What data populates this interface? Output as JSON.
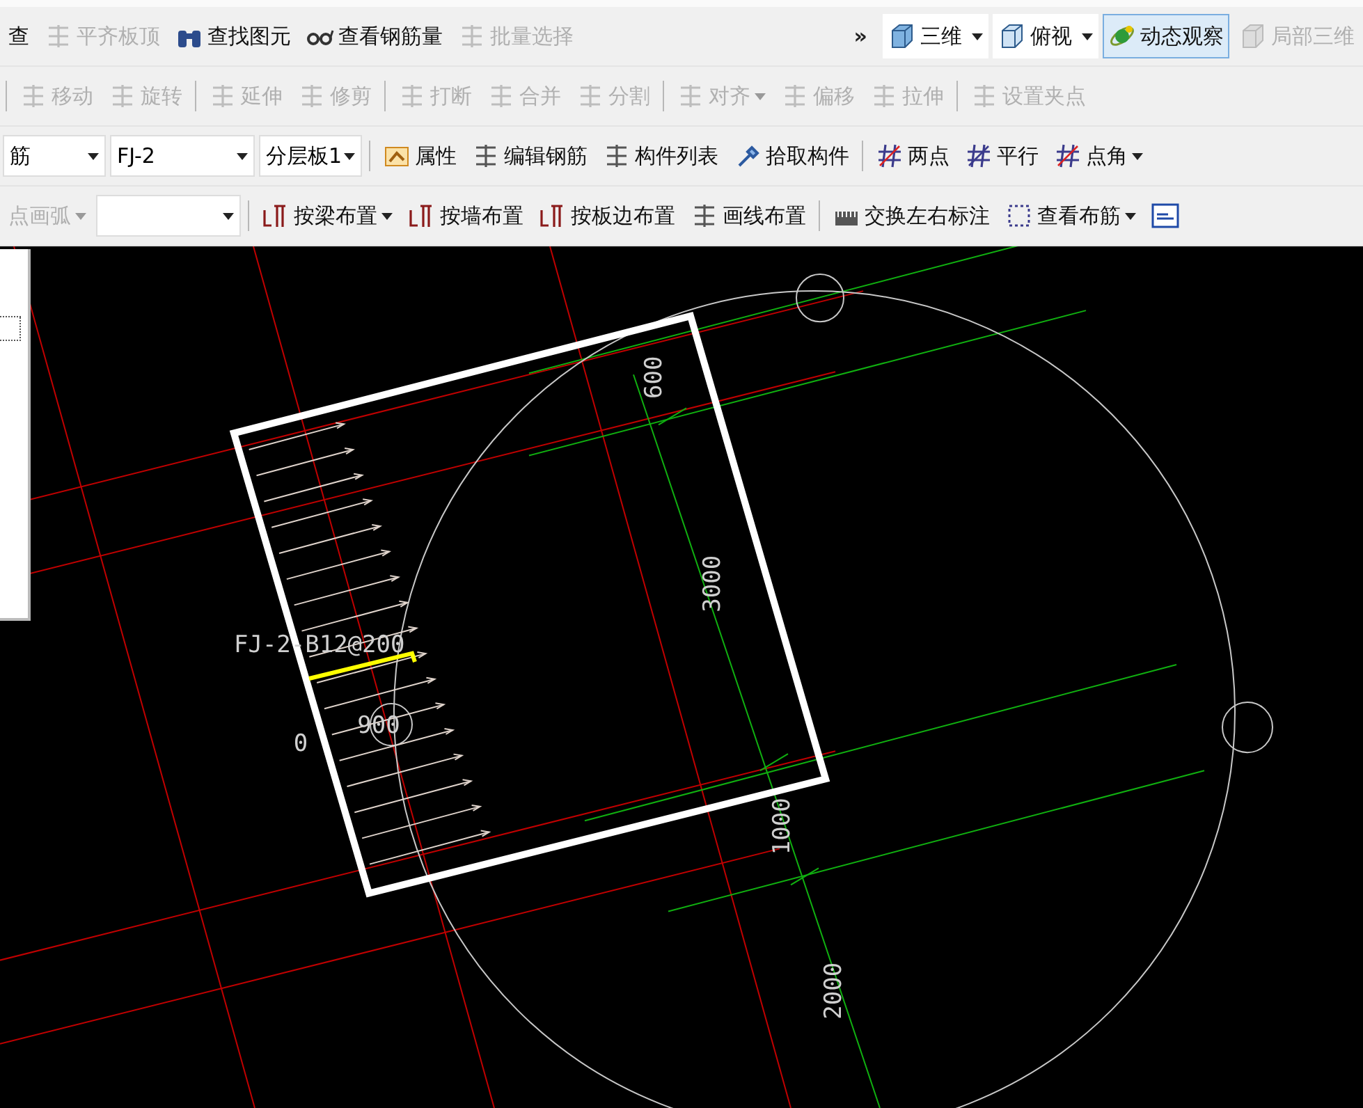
{
  "toolbar_rows": [
    {
      "items": [
        {
          "kind": "label",
          "label": "查",
          "disabled": false
        },
        {
          "kind": "button",
          "label": "平齐板顶",
          "disabled": true
        },
        {
          "kind": "button",
          "label": "查找图元",
          "disabled": false
        },
        {
          "kind": "button",
          "label": "查看钢筋量",
          "disabled": false
        },
        {
          "kind": "button",
          "label": "批量选择",
          "disabled": true
        },
        {
          "kind": "more",
          "label": "»"
        },
        {
          "kind": "split",
          "label": "三维"
        },
        {
          "kind": "split",
          "label": "俯视"
        },
        {
          "kind": "button",
          "label": "动态观察",
          "selected": true
        },
        {
          "kind": "button",
          "label": "局部三维",
          "disabled": true
        }
      ]
    },
    {
      "items": [
        {
          "kind": "separator"
        },
        {
          "kind": "button",
          "label": "移动",
          "disabled": true
        },
        {
          "kind": "button",
          "label": "旋转",
          "disabled": true
        },
        {
          "kind": "separator"
        },
        {
          "kind": "button",
          "label": "延伸",
          "disabled": true
        },
        {
          "kind": "button",
          "label": "修剪",
          "disabled": true
        },
        {
          "kind": "separator"
        },
        {
          "kind": "button",
          "label": "打断",
          "disabled": true
        },
        {
          "kind": "button",
          "label": "合并",
          "disabled": true
        },
        {
          "kind": "button",
          "label": "分割",
          "disabled": true
        },
        {
          "kind": "separator"
        },
        {
          "kind": "button",
          "label": "对齐",
          "disabled": true,
          "dropdown": true
        },
        {
          "kind": "button",
          "label": "偏移",
          "disabled": true
        },
        {
          "kind": "button",
          "label": "拉伸",
          "disabled": true
        },
        {
          "kind": "separator"
        },
        {
          "kind": "button",
          "label": "设置夹点",
          "disabled": true
        }
      ]
    },
    {
      "items": [
        {
          "kind": "combo",
          "value": "筋"
        },
        {
          "kind": "combo",
          "value": "FJ-2"
        },
        {
          "kind": "combo",
          "value": "分层板1"
        },
        {
          "kind": "separator"
        },
        {
          "kind": "button",
          "label": "属性"
        },
        {
          "kind": "button",
          "label": "编辑钢筋"
        },
        {
          "kind": "button",
          "label": "构件列表"
        },
        {
          "kind": "button",
          "label": "拾取构件"
        },
        {
          "kind": "separator"
        },
        {
          "kind": "button",
          "label": "两点"
        },
        {
          "kind": "button",
          "label": "平行"
        },
        {
          "kind": "button",
          "label": "点角",
          "dropdown": true
        }
      ]
    },
    {
      "items": [
        {
          "kind": "button",
          "label": "点画弧",
          "disabled": true,
          "dropdown": true
        },
        {
          "kind": "combo",
          "value": ""
        },
        {
          "kind": "separator"
        },
        {
          "kind": "button",
          "label": "按梁布置",
          "dropdown": true
        },
        {
          "kind": "button",
          "label": "按墙布置"
        },
        {
          "kind": "button",
          "label": "按板边布置"
        },
        {
          "kind": "button",
          "label": "画线布置"
        },
        {
          "kind": "separator"
        },
        {
          "kind": "button",
          "label": "交换左右标注"
        },
        {
          "kind": "button",
          "label": "查看布筋",
          "dropdown": true
        },
        {
          "kind": "button"
        }
      ]
    }
  ],
  "canvas": {
    "rebar_label": "FJ-2-B12@200",
    "left_labels": [
      "0",
      "900"
    ],
    "axis_dimensions": [
      "600",
      "3000",
      "1000",
      "2000"
    ]
  }
}
